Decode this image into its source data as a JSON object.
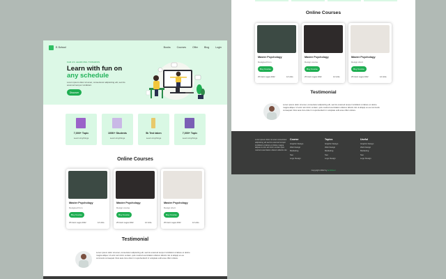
{
  "nav": {
    "logo": "E-School",
    "links": [
      "Books",
      "Courses",
      "Offer",
      "Blog",
      "Login"
    ]
  },
  "hero": {
    "tagline": "FAR AS LEARNING TOWARDS",
    "title_line1": "Learn with fun on",
    "title_line2": "any schedule",
    "description": "Lorem ipsum dolor sit amet, consectetur adipisicing elit, sed do eiusmod tempor incididunt.",
    "button": "Discover"
  },
  "features": [
    {
      "title": "7,000+ Topic",
      "subtitle": "Learn Anythings",
      "icon": "book-icon",
      "color": "#9b63c9"
    },
    {
      "title": "100K+ Students",
      "subtitle": "Learn Anythings",
      "icon": "notepad-icon",
      "color": "#c9b8e6"
    },
    {
      "title": "5k Test taken",
      "subtitle": "Learn Anythings",
      "icon": "pencil-icon",
      "color": "#e8c96b"
    },
    {
      "title": "7,000+ Topic",
      "subtitle": "Learn Anythings",
      "icon": "document-icon",
      "color": "#7a5fb5"
    }
  ],
  "courses_title": "Online Courses",
  "courses": [
    {
      "title": "Master Psychology",
      "subtitle": "Designed from",
      "button": "Buy Course",
      "meta_left": "25 Intern Lagos 2022",
      "meta_right": "12 Units",
      "image": "lecture-photo"
    },
    {
      "title": "Master Psychology",
      "subtitle": "Design course",
      "button": "Buy Course",
      "meta_left": "25 Intern Lagos 2022",
      "meta_right": "12 Units",
      "image": "reading-photo"
    },
    {
      "title": "Master Psychology",
      "subtitle": "Design short",
      "button": "Buy Course",
      "meta_left": "25 Intern Lagos 2022",
      "meta_right": "12 Units",
      "image": "laptop-photo"
    }
  ],
  "testimonial": {
    "title": "Testimonial",
    "text": "Lorem ipsum dolor sit amet, consectetur adipisicing elit, sed do eiusmod tempor incididunt ut labore et dolore magna aliqua. Ut enim ad minim veniam, quis nostrud exercitation ullamco laboris nisi ut aliquip ex ea commodo consequat. Duis aute irure dolor in reprehenderit in voluptate velit esse cillum dolore."
  },
  "footer": {
    "about": "Lorem ipsum dolor sit amet consectetur adipisicing elit sed do eiusmod tempor incididunt ut labore et dolore magna aliqua ut enim ad minim veniam quis nostrud exercitation ullamco laboris nisi.",
    "columns": [
      {
        "head": "Course",
        "items": [
          "Graphic Design",
          "Web Design",
          "Marketing",
          "Seo",
          "Logo Design"
        ]
      },
      {
        "head": "Topics",
        "items": [
          "Graphic Design",
          "Web Design",
          "Marketing",
          "Seo",
          "Logo Design"
        ]
      },
      {
        "head": "Useful",
        "items": [
          "Graphic Design",
          "Web Design",
          "Marketing",
          "Seo",
          "Logo Design"
        ]
      }
    ],
    "copyright": "Copyright 2022 by",
    "copyright_accent": "E-School"
  },
  "colors": {
    "accent": "#1fae52",
    "mint": "#dcf8e6",
    "footer": "#3a3b3a",
    "background": "#b1bab5"
  }
}
